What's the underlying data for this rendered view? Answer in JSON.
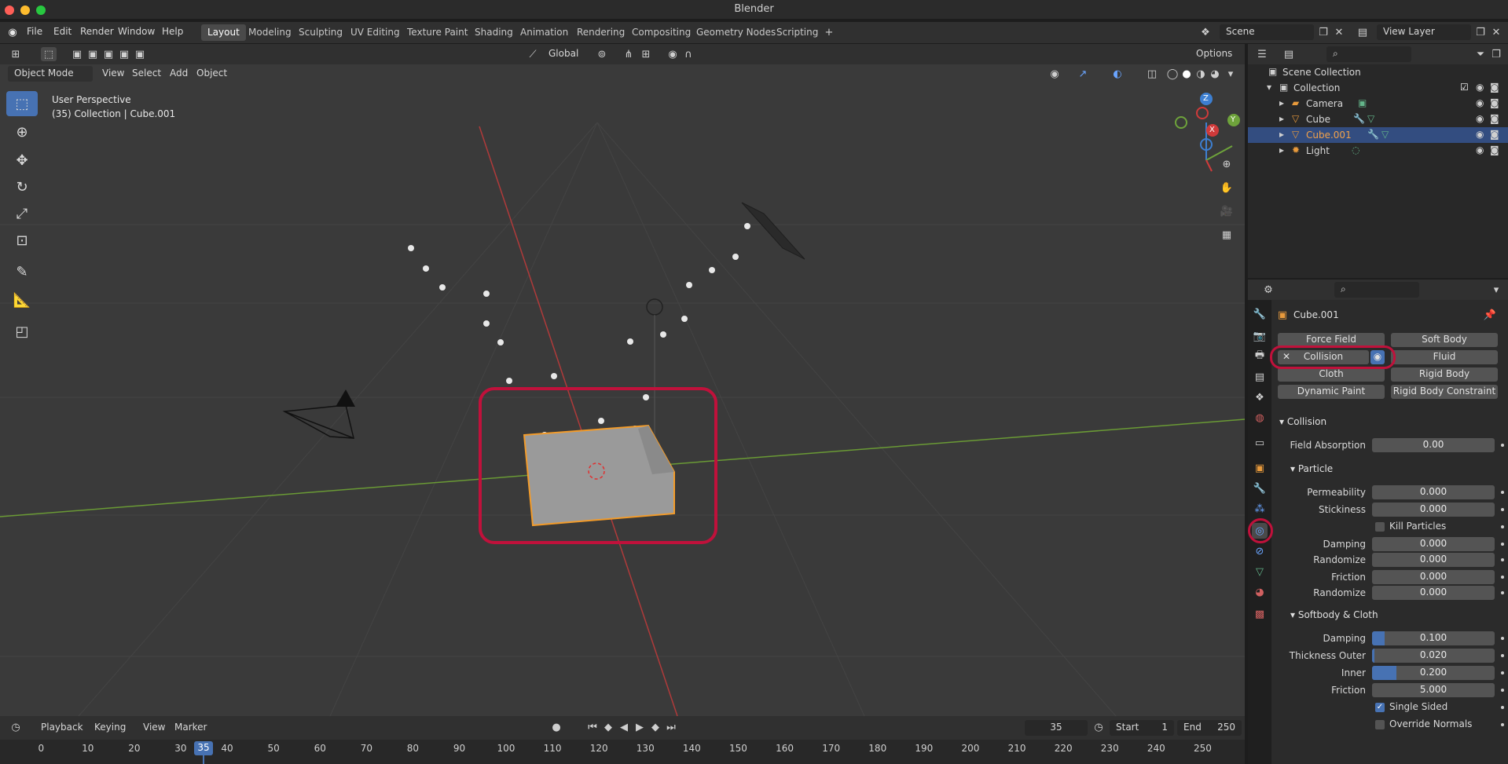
{
  "app": {
    "title": "Blender"
  },
  "colors": {
    "accent": "#4772b3",
    "highlight": "#c0113b",
    "selection_orange": "#f29b2a"
  },
  "menu": [
    "File",
    "Edit",
    "Render",
    "Window",
    "Help"
  ],
  "workspaces": [
    "Layout",
    "Modeling",
    "Sculpting",
    "UV Editing",
    "Texture Paint",
    "Shading",
    "Animation",
    "Rendering",
    "Compositing",
    "Geometry Nodes",
    "Scripting"
  ],
  "scene": {
    "scene_name": "Scene",
    "view_layer": "View Layer"
  },
  "viewport": {
    "transform_orientation": "Global",
    "options_label": "Options",
    "mode": "Object Mode",
    "header_menus": [
      "View",
      "Select",
      "Add",
      "Object"
    ],
    "info_line1": "User Perspective",
    "info_line2": "(35) Collection | Cube.001",
    "gizmo_labels": [
      "Z",
      "Y",
      "X"
    ]
  },
  "outliner": {
    "scene_collection": "Scene Collection",
    "collection": "Collection",
    "items": [
      {
        "name": "Camera"
      },
      {
        "name": "Cube"
      },
      {
        "name": "Cube.001",
        "selected": true
      },
      {
        "name": "Light"
      }
    ]
  },
  "properties": {
    "object_name": "Cube.001",
    "physics_buttons": {
      "force_field": "Force Field",
      "soft_body": "Soft Body",
      "collision": "Collision",
      "fluid": "Fluid",
      "cloth": "Cloth",
      "rigid_body": "Rigid Body",
      "dynamic_paint": "Dynamic Paint",
      "rigid_body_constraint": "Rigid Body Constraint"
    },
    "collision_panel": {
      "title": "Collision",
      "field_absorption_label": "Field Absorption",
      "field_absorption": "0.00",
      "particle_title": "Particle",
      "permeability_label": "Permeability",
      "permeability": "0.000",
      "stickiness_label": "Stickiness",
      "stickiness": "0.000",
      "kill_particles_label": "Kill Particles",
      "damping_label": "Damping",
      "damping": "0.000",
      "randomize_label": "Randomize",
      "randomize": "0.000",
      "friction_label": "Friction",
      "friction": "0.000",
      "randomize2_label": "Randomize",
      "randomize2": "0.000",
      "softbody_title": "Softbody & Cloth",
      "sb_damping_label": "Damping",
      "sb_damping": "0.100",
      "sb_damping_fill": 0.1,
      "thickness_outer_label": "Thickness Outer",
      "thickness_outer": "0.020",
      "thickness_outer_fill": 0.02,
      "inner_label": "Inner",
      "inner": "0.200",
      "inner_fill": 0.2,
      "sb_friction_label": "Friction",
      "sb_friction": "5.000",
      "single_sided_label": "Single Sided",
      "override_normals_label": "Override Normals"
    }
  },
  "timeline": {
    "menus": [
      "Playback",
      "Keying",
      "View",
      "Marker"
    ],
    "current_frame": "35",
    "start_label": "Start",
    "start": "1",
    "end_label": "End",
    "end": "250",
    "ticks": [
      "0",
      "10",
      "20",
      "30",
      "40",
      "50",
      "60",
      "70",
      "80",
      "90",
      "100",
      "110",
      "120",
      "130",
      "140",
      "150",
      "160",
      "170",
      "180",
      "190",
      "200",
      "210",
      "220",
      "230",
      "240",
      "250"
    ]
  }
}
